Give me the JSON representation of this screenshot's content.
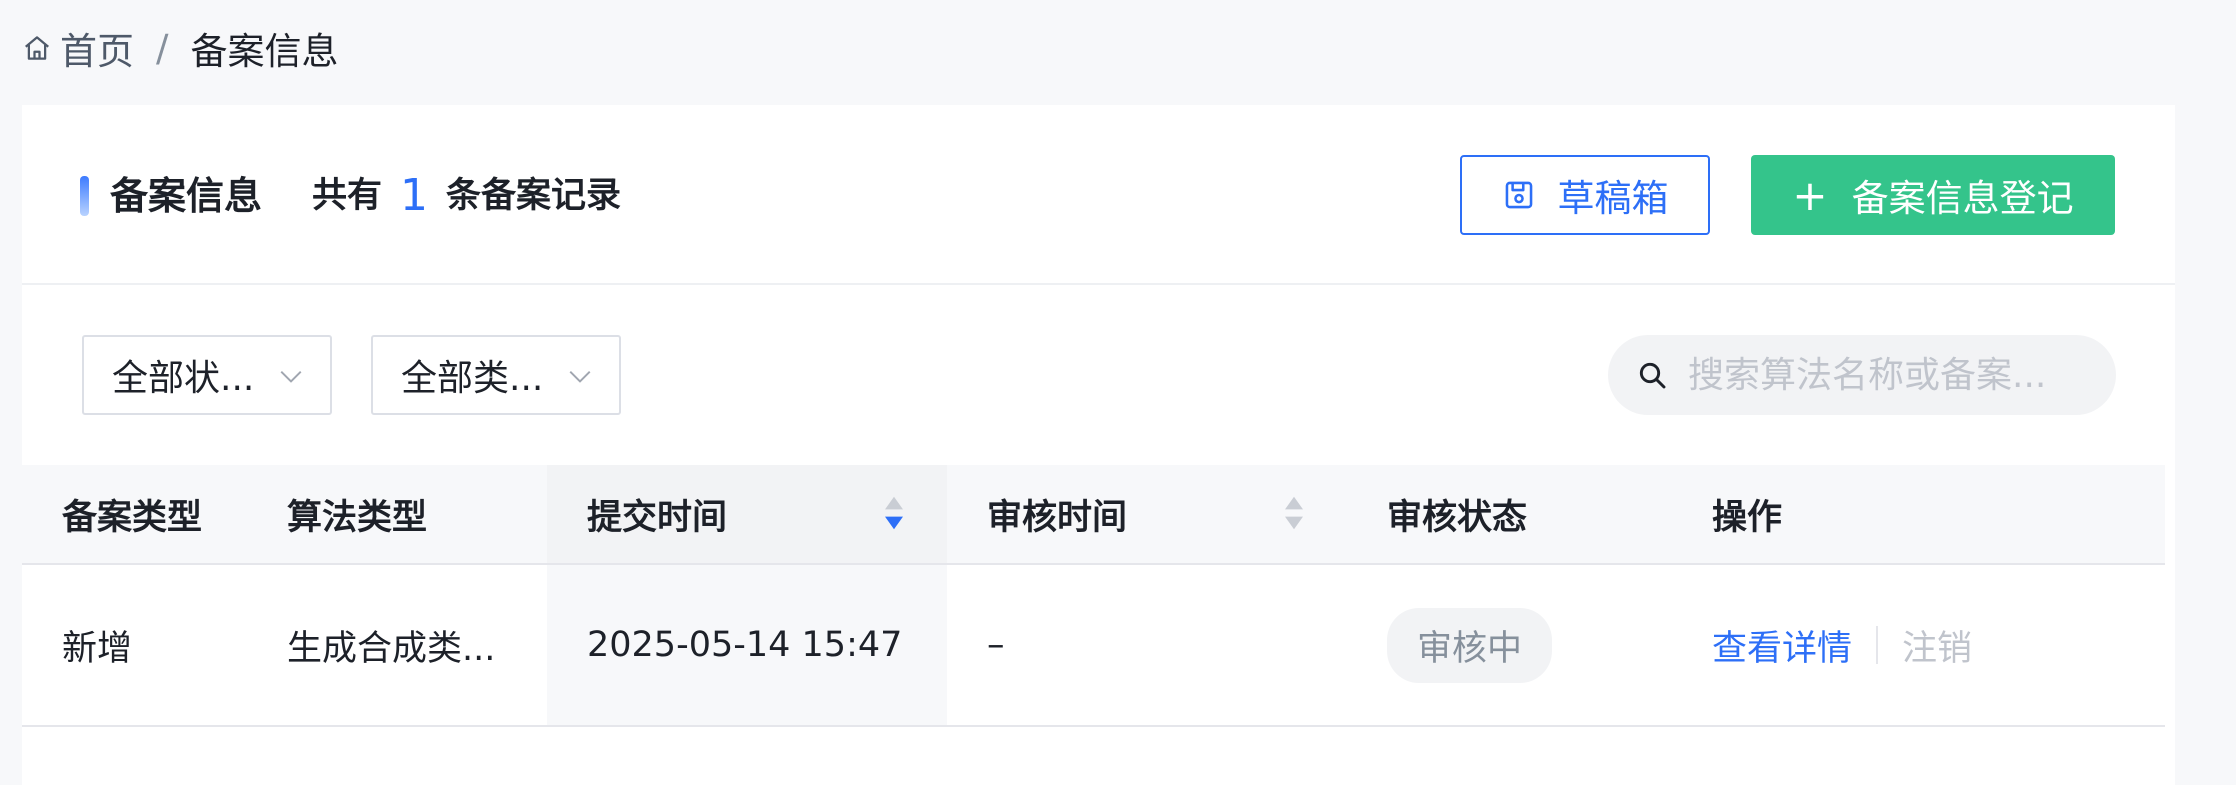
{
  "breadcrumb": {
    "home": "首页",
    "separator": "/",
    "current": "备案信息"
  },
  "header": {
    "title": "备案信息",
    "count_prefix": "共有",
    "count": "1",
    "count_suffix": "条备案记录",
    "draft_button": "草稿箱",
    "add_button": "备案信息登记",
    "add_icon": "+"
  },
  "filters": {
    "status_select": "全部状...",
    "type_select": "全部类...",
    "search_placeholder": "搜索算法名称或备案..."
  },
  "table": {
    "columns": [
      "备案类型",
      "算法类型",
      "提交时间",
      "审核时间",
      "审核状态",
      "操作"
    ],
    "rows": [
      {
        "filing_type": "新增",
        "algorithm_type": "生成合成类...",
        "submit_time": "2025-05-14 15:47",
        "review_time": "–",
        "status": "审核中",
        "action_view": "查看详情",
        "action_cancel": "注销"
      }
    ]
  },
  "colors": {
    "primary": "#2d6ff7",
    "success": "#34c48b",
    "muted": "#c0c4cc"
  },
  "icons": [
    "home-icon",
    "save-icon",
    "plus-icon",
    "chevron-down-icon",
    "search-icon",
    "sort-icon"
  ]
}
